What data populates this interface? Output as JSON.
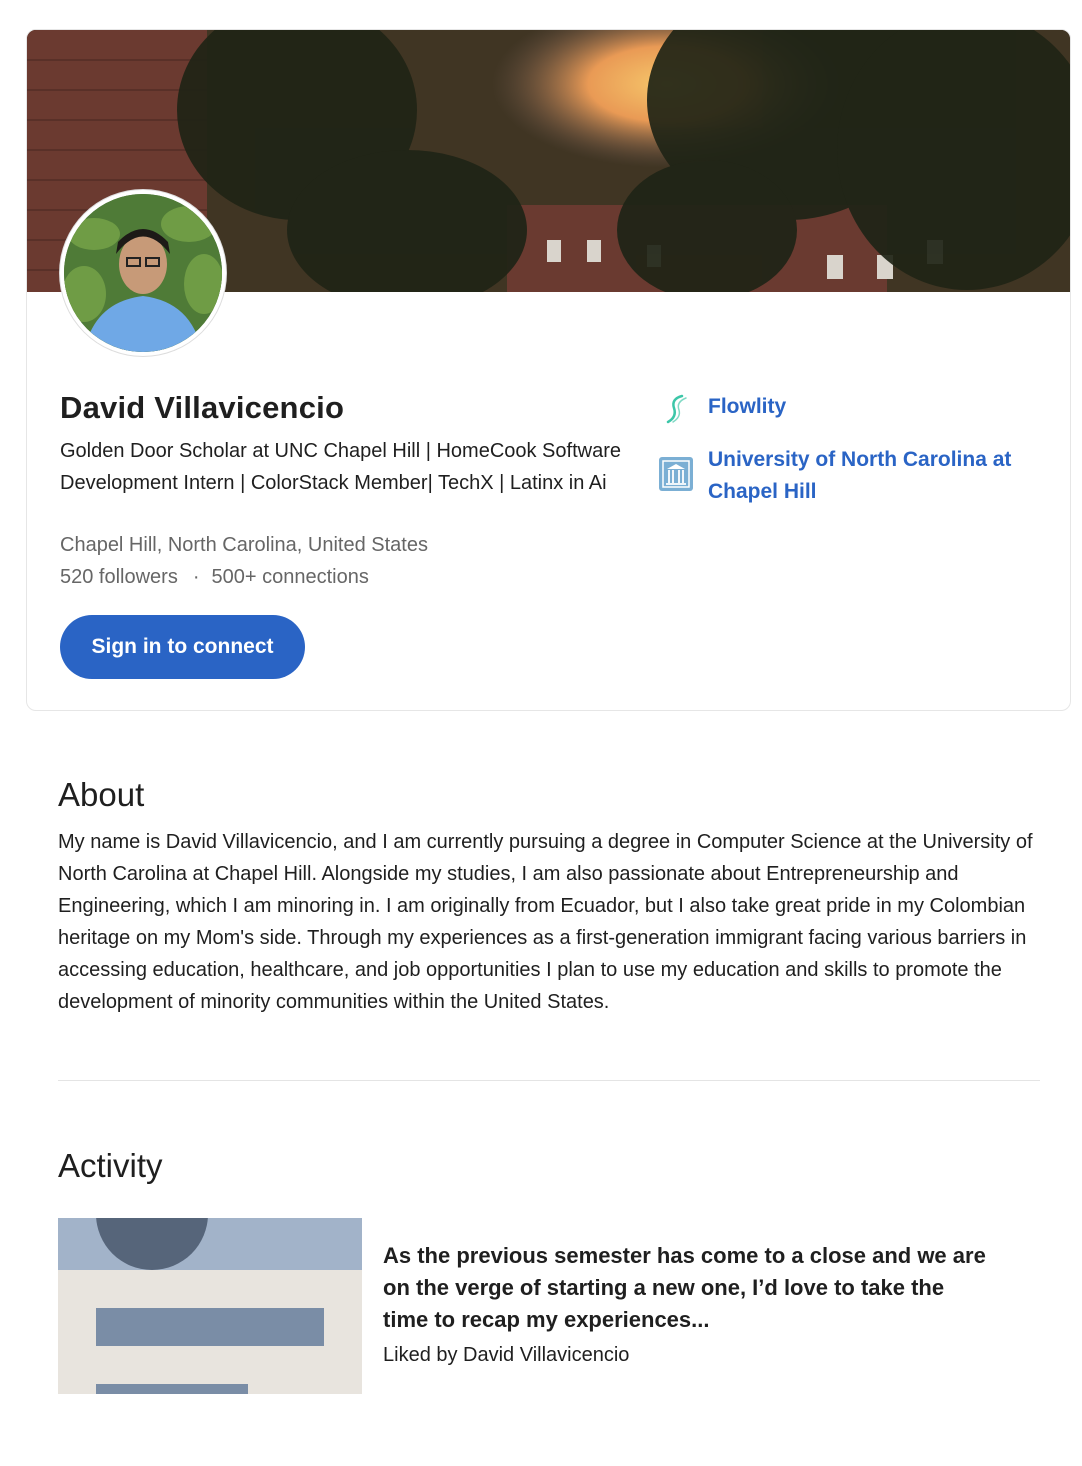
{
  "profile": {
    "name": "David Villavicencio",
    "headline": "Golden Door Scholar at UNC Chapel Hill | HomeCook Software Development Intern | ColorStack Member| TechX | Latinx in Ai",
    "location": "Chapel Hill, North Carolina, United States",
    "followers": "520 followers",
    "separator": "·",
    "connections": "500+ connections",
    "connect_label": "Sign in to connect"
  },
  "sidebar": {
    "items": [
      {
        "label": "Flowlity",
        "icon": "flowlity-logo-icon"
      },
      {
        "label": "University of North Carolina at Chapel Hill",
        "icon": "unc-logo-icon"
      }
    ]
  },
  "about": {
    "title": "About",
    "text": "My name is David Villavicencio, and I am currently pursuing a degree in Computer Science at the University of North Carolina at Chapel Hill. Alongside my studies, I am also passionate about Entrepreneurship and Engineering, which I am minoring in. I am originally from Ecuador, but I also take great pride in my Colombian heritage on my Mom's side. Through my experiences as a first-generation immigrant facing various barriers in accessing education, healthcare, and job opportunities I plan to use my education and skills to promote the development of minority communities within the United States."
  },
  "activity": {
    "title": "Activity",
    "post_title": "As the previous semester has come to a close and we are on the verge of starting a new one, I’d love to take the time to recap my experiences...",
    "post_meta": "Liked by David Villavicencio"
  },
  "colors": {
    "accent": "#2a64c5",
    "muted_text": "#666666"
  }
}
